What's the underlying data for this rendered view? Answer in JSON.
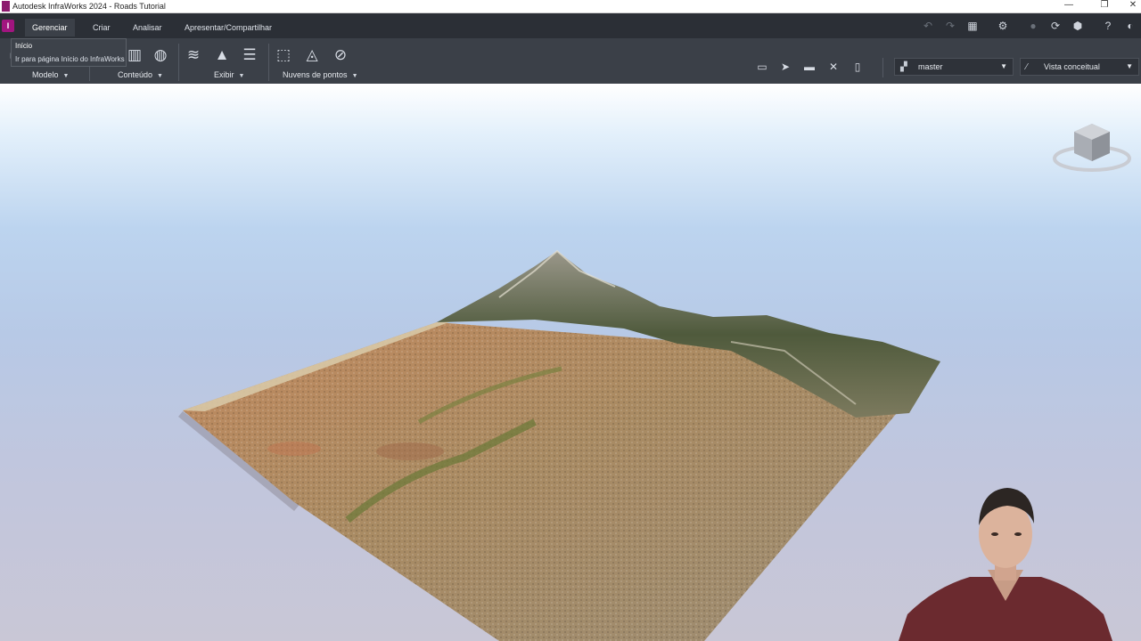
{
  "window": {
    "title": "Autodesk InfraWorks 2024 - Roads Tutorial",
    "minimize": "—",
    "maximize": "❐",
    "close": "✕"
  },
  "app_button_letter": "I",
  "tabs": [
    {
      "label": "Gerenciar",
      "active": true
    },
    {
      "label": "Criar",
      "active": false
    },
    {
      "label": "Analisar",
      "active": false
    },
    {
      "label": "Apresentar/Compartilhar",
      "active": false
    }
  ],
  "ribbon_groups": {
    "modelo": "Modelo",
    "conteudo": "Conteúdo",
    "exibir": "Exibir",
    "nuvens": "Nuvens de pontos"
  },
  "tooltip": {
    "title": "Início",
    "description": "Ir para página Início do InfraWorks"
  },
  "proposal_dropdown": {
    "value": "master"
  },
  "visual_style_dropdown": {
    "value": "Vista conceitual"
  },
  "icons": {
    "undo": "undo-icon",
    "redo": "redo-icon",
    "settings": "gear-icon",
    "sync": "refresh-icon",
    "help": "help-icon",
    "user": "user-avatar-icon",
    "layers": "layers-icon",
    "terrain": "terrain-icon",
    "list": "list-icon",
    "globe": "globe-icon"
  },
  "colors": {
    "ribbon": "#3b4048",
    "tabrow": "#2b2f36",
    "brand": "#a1157f"
  }
}
